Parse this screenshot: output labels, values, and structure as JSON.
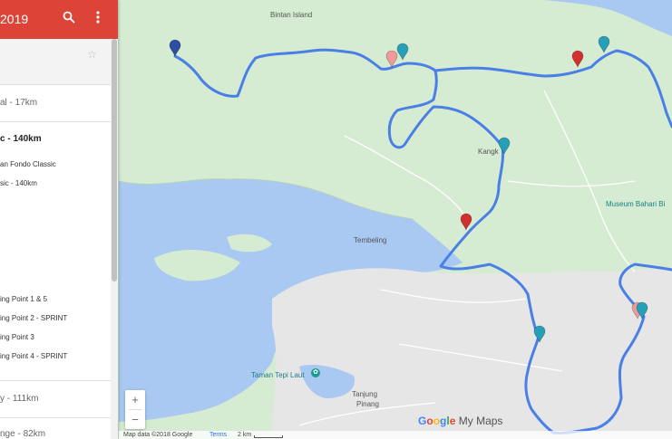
{
  "panel": {
    "title": "2019",
    "layers": [
      {
        "name": "al - 17km",
        "active": false
      },
      {
        "name": "c - 140km",
        "active": true
      },
      {
        "name": "y - 111km",
        "active": false
      },
      {
        "name": "nge - 82km",
        "active": false
      }
    ],
    "active_items": [
      "an Fondo Classic",
      "sic - 140km",
      "ing Point 1 & 5",
      "ing Point 2 - SPRINT",
      "ing Point 3",
      "ing Point 4 - SPRINT"
    ]
  },
  "map": {
    "place_labels": [
      "Bintan Island",
      "Kangk",
      "Tembeling",
      "Museum Bahari Bi",
      "Taman Tepi Laut",
      "Tanjung",
      "Pinang"
    ],
    "water_color": "#a9c8f2",
    "land_color": "#d6ecd2",
    "urban_color": "#e6e6e6",
    "route_color": "#4a7fe6",
    "markers": [
      {
        "color": "#2b4fa0"
      },
      {
        "color": "#ef9a9a"
      },
      {
        "color": "#26a0b8"
      },
      {
        "color": "#d32f2f"
      },
      {
        "color": "#26a0b8"
      },
      {
        "color": "#26a0b8"
      },
      {
        "color": "#d32f2f"
      },
      {
        "color": "#26a0b8"
      },
      {
        "color": "#ef9a9a"
      },
      {
        "color": "#26a0b8"
      }
    ]
  },
  "controls": {
    "zoom_in": "+",
    "zoom_out": "−"
  },
  "branding": {
    "google": "Google",
    "my_maps": "My Maps"
  },
  "footer": {
    "map_data": "Map data ©2018 Google",
    "terms": "Terms",
    "scale": "2 km"
  }
}
